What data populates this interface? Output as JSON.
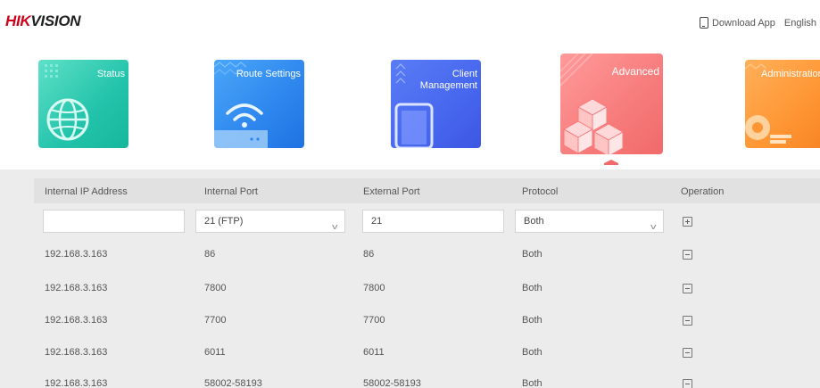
{
  "header": {
    "logo_red": "HIK",
    "logo_dark": "VISION",
    "download_app": "Download App",
    "language": "English"
  },
  "nav_tiles": [
    {
      "label": "Status",
      "icon": "globe-icon",
      "color": "#22c3aa"
    },
    {
      "label": "Route Settings",
      "icon": "wifi-router-icon",
      "color": "#2d86ee"
    },
    {
      "label_line1": "Client",
      "label_line2": "Management",
      "icon": "phone-icon",
      "color": "#4767ee"
    },
    {
      "label": "Advanced",
      "icon": "cubes-icon",
      "color": "#f77b7b",
      "active": true
    },
    {
      "label": "Administration",
      "icon": "gear-icon",
      "color": "#ff9634"
    }
  ],
  "table": {
    "columns": [
      "Internal IP Address",
      "Internal Port",
      "External Port",
      "Protocol",
      "Operation"
    ],
    "input_row": {
      "ip_value": "",
      "internal_port": "21 (FTP)",
      "external_port": "21",
      "protocol": "Both"
    },
    "rows": [
      {
        "ip": "192.168.3.163",
        "internal": "86",
        "external": "86",
        "protocol": "Both"
      },
      {
        "ip": "192.168.3.163",
        "internal": "7800",
        "external": "7800",
        "protocol": "Both"
      },
      {
        "ip": "192.168.3.163",
        "internal": "7700",
        "external": "7700",
        "protocol": "Both"
      },
      {
        "ip": "192.168.3.163",
        "internal": "6011",
        "external": "6011",
        "protocol": "Both"
      },
      {
        "ip": "192.168.3.163",
        "internal": "58002-58193",
        "external": "58002-58193",
        "protocol": "Both"
      }
    ]
  }
}
